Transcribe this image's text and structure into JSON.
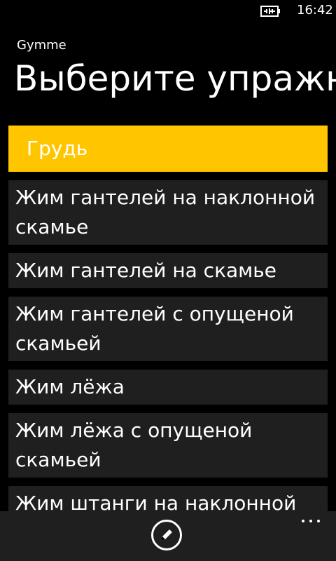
{
  "status": {
    "time": "16:42"
  },
  "app": {
    "name": "Gymme",
    "page_title": "Выберите упражнение"
  },
  "colors": {
    "accent": "#ffc600",
    "item_bg": "#1f1f1f",
    "background": "#000000"
  },
  "list": {
    "group_header": "Грудь",
    "items": [
      "Жим гантелей на наклонной скамье",
      "Жим гантелей на скамье",
      "Жим гантелей с опущеной скамьей",
      "Жим лёжа",
      "Жим лёжа с опущеной скамьей",
      "Жим штанги на наклонной скамье"
    ]
  },
  "appbar": {
    "edit_icon": "edit-icon",
    "more_icon": "ellipsis-icon"
  }
}
